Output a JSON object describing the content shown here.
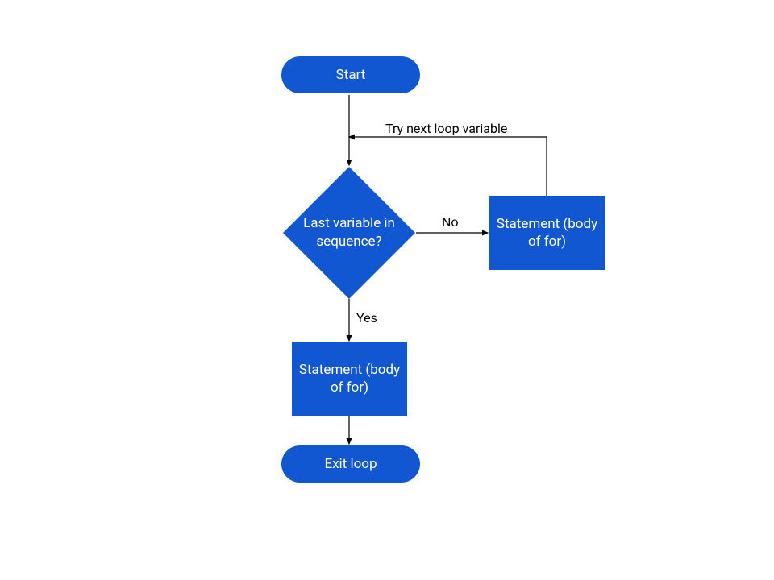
{
  "diagram": {
    "type": "flowchart",
    "nodes": {
      "start": {
        "label": "Start",
        "shape": "terminal"
      },
      "decision": {
        "label": "Last variable in sequence?",
        "shape": "decision"
      },
      "body_no": {
        "label": "Statement (body of for)",
        "shape": "process"
      },
      "body_yes": {
        "label": "Statement (body of for)",
        "shape": "process"
      },
      "exit": {
        "label": "Exit loop",
        "shape": "terminal"
      }
    },
    "edges": {
      "no": {
        "label": "No",
        "from": "decision",
        "to": "body_no"
      },
      "yes": {
        "label": "Yes",
        "from": "decision",
        "to": "body_yes"
      },
      "loop": {
        "label": "Try next loop variable",
        "from": "body_no",
        "to": "decision"
      }
    },
    "colors": {
      "fill": "#1157d1",
      "text": "#ffffff",
      "line": "#000000"
    }
  }
}
